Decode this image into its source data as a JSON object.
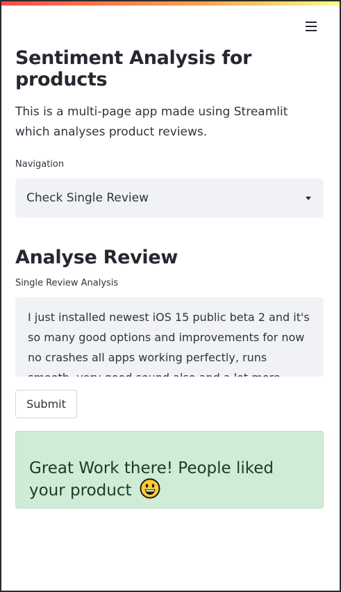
{
  "app": {
    "title": "Sentiment Analysis for products",
    "description": "This is a multi-page app made using Streamlit which analyses product reviews."
  },
  "sidebar_nav": {
    "label": "Navigation",
    "selected": "Check Single Review"
  },
  "section": {
    "heading": "Analyse Review",
    "input_label": "Single Review Analysis",
    "review_text": "I just installed newest iOS 15 public beta 2 and it's so many good options and improvements for now no crashes all apps working perfectly, runs smooth, very good sound also and a lot more features",
    "submit_label": "Submit"
  },
  "result": {
    "message": "Great Work there! People liked your product",
    "icon": "grinning-face-emoji",
    "status_color": "#d0ecd7"
  },
  "theme": {
    "accent_gradient": [
      "#ff4b4b",
      "#f6a44c",
      "#fffd80"
    ],
    "text": "#262730",
    "input_bg": "#f0f2f6"
  }
}
